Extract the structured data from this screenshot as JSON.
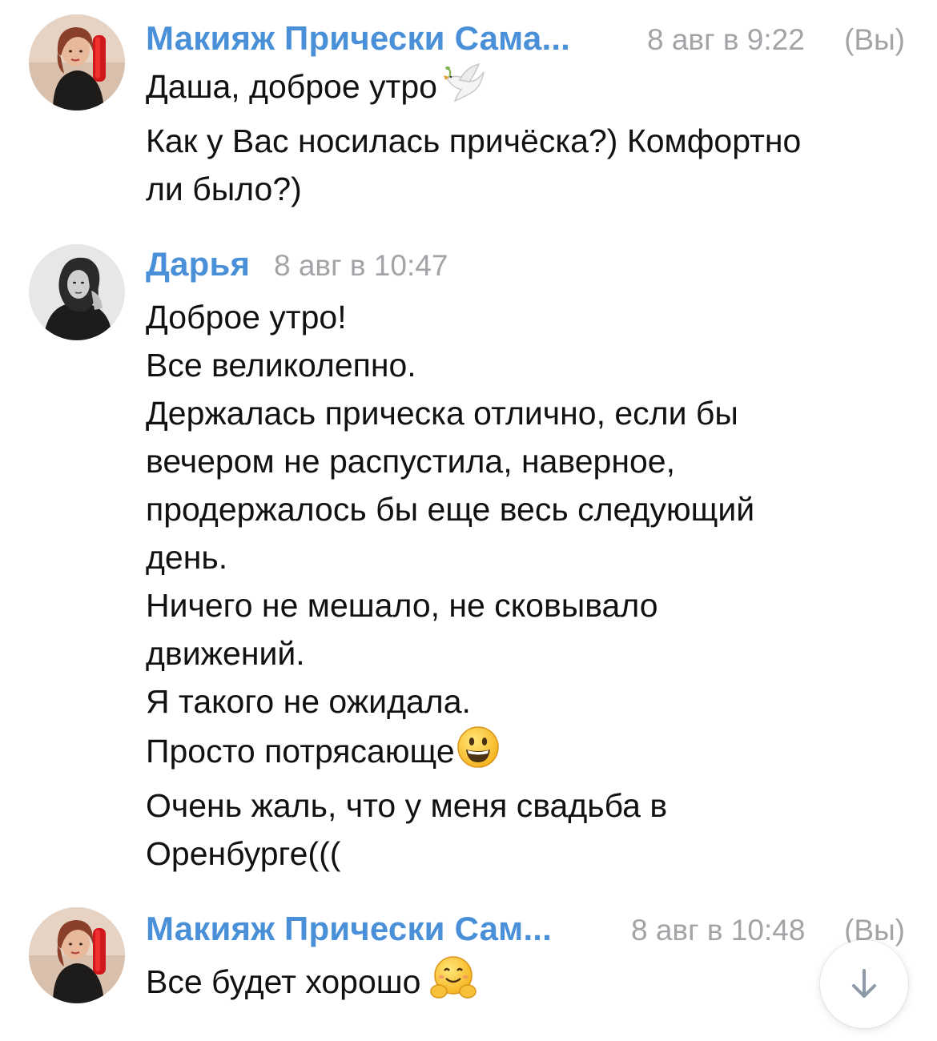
{
  "messages": [
    {
      "author": "Макияж Прически Сама...",
      "time": "8 авг в 9:22",
      "you_label": "(Вы)",
      "avatar_icon": "woman-with-red-shoe-avatar",
      "lines": [
        "Даша, доброе утро",
        "Как у Вас носилась причёска?) Комфортно",
        "ли было?)"
      ],
      "emoji": "dove-emoji"
    },
    {
      "author": "Дарья",
      "time": "8 авг в 10:47",
      "avatar_icon": "woman-black-and-white-avatar",
      "lines": [
        "Доброе утро!",
        "Все великолепно.",
        "Держалась прическа отлично, если бы",
        "вечером не распустила, наверное,",
        "продержалось бы еще весь следующий",
        "день.",
        "Ничего не мешало, не сковывало",
        "движений.",
        "Я такого не ожидала.",
        "Просто потрясающе",
        "Очень жаль, что у меня свадьба в",
        "Оренбурге((("
      ],
      "emoji": "smiley-emoji"
    },
    {
      "author": "Макияж Прически Сам...",
      "time": "8 авг в 10:48",
      "you_label": "(Вы)",
      "avatar_icon": "woman-with-red-shoe-avatar",
      "lines": [
        "Все будет хорошо"
      ],
      "emoji": "hugging-face-emoji"
    }
  ],
  "scroll_down_icon": "arrow-down-icon",
  "colors": {
    "author": "#4a90d9",
    "meta": "#a3a3a8",
    "text": "#111111"
  }
}
